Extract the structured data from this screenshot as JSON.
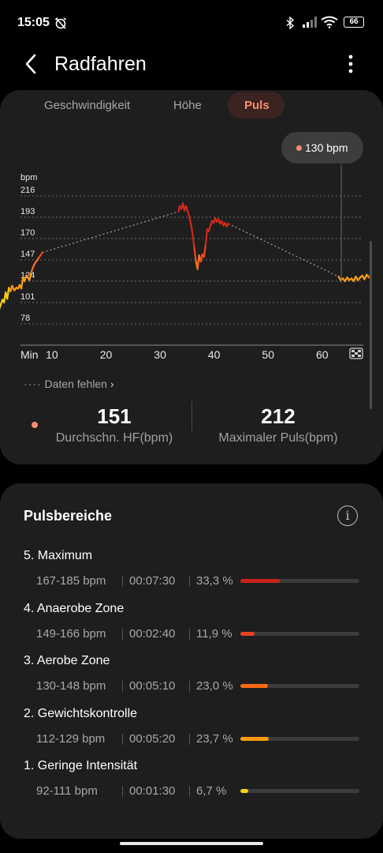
{
  "status": {
    "time": "15:05",
    "battery": "66"
  },
  "header": {
    "title": "Radfahren"
  },
  "tabs": [
    {
      "label": "Geschwindigkeit",
      "active": false
    },
    {
      "label": "Höhe",
      "active": false
    },
    {
      "label": "Puls",
      "active": true
    }
  ],
  "tooltip": {
    "label": "130 bpm"
  },
  "chart_data": {
    "type": "line",
    "ylabel": "bpm",
    "y_ticks": [
      "216",
      "193",
      "170",
      "147",
      "124",
      "101",
      "78"
    ],
    "x_ticks": [
      "Min",
      "10",
      "20",
      "30",
      "40",
      "50",
      "60"
    ],
    "ylim": [
      78,
      216
    ],
    "xlim": [
      0,
      66
    ],
    "grid": true,
    "marker_x": 63.5,
    "segments": [
      {
        "x": [
          0,
          0.4,
          0.8,
          1.1,
          1.4,
          1.7,
          2.0,
          2.3,
          2.6,
          3.0,
          3.4,
          3.7,
          4.0,
          4.3,
          4.6,
          4.9,
          5.2,
          5.5,
          5.8,
          6.1,
          6.4,
          6.7,
          7.0,
          7.3,
          7.6,
          7.9,
          8.2
        ],
        "y": [
          90,
          97,
          104,
          101,
          112,
          105,
          117,
          113,
          119,
          114,
          117,
          116,
          120,
          116,
          127,
          124,
          130,
          128,
          125,
          133,
          138,
          142,
          145,
          147,
          150,
          152,
          155
        ]
      },
      {
        "x": [
          33.4,
          33.6,
          33.9,
          34.2,
          34.5,
          34.8,
          35.1,
          35.4,
          35.7,
          36.0,
          36.3,
          36.6,
          36.9,
          37.2,
          37.5,
          37.8,
          38.1,
          38.4,
          38.7,
          39.0,
          39.3,
          39.6,
          39.9,
          40.2,
          40.5,
          40.8,
          41.1,
          41.4,
          41.7,
          42.0,
          42.3,
          42.6
        ],
        "y": [
          199,
          205,
          202,
          208,
          200,
          205,
          199,
          193,
          185,
          175,
          160,
          146,
          137,
          152,
          145,
          153,
          150,
          163,
          180,
          178,
          184,
          189,
          187,
          192,
          188,
          191,
          186,
          189,
          184,
          187,
          183,
          186
        ]
      },
      {
        "x": [
          63.0,
          63.4,
          63.8,
          64.2,
          64.6,
          65.0,
          65.4,
          65.8,
          66.2,
          66.6,
          67.0,
          67.4,
          67.8,
          68.2,
          68.6,
          69.0
        ],
        "y": [
          129,
          125,
          127,
          124,
          128,
          125,
          127,
          124,
          129,
          125,
          128,
          130,
          126,
          131,
          128,
          132
        ]
      }
    ],
    "gaps": [
      {
        "x": [
          8.2,
          33.4
        ],
        "y": [
          155,
          199
        ]
      },
      {
        "x": [
          42.6,
          63.0
        ],
        "y": [
          186,
          129
        ]
      }
    ]
  },
  "missing_data_label": "Daten fehlen",
  "stats": [
    {
      "value": "151",
      "label": "Durchschn. HF(bpm)"
    },
    {
      "value": "212",
      "label": "Maximaler Puls(bpm)"
    }
  ],
  "zones": {
    "title": "Pulsbereiche",
    "items": [
      {
        "name": "5. Maximum",
        "range": "167-185 bpm",
        "time": "00:07:30",
        "percent": "33,3 %",
        "fraction": 0.333,
        "color": "#c8231a"
      },
      {
        "name": "4. Anaerobe Zone",
        "range": "149-166 bpm",
        "time": "00:02:40",
        "percent": "11,9 %",
        "fraction": 0.119,
        "color": "#e8421f"
      },
      {
        "name": "3. Aerobe Zone",
        "range": "130-148 bpm",
        "time": "00:05:10",
        "percent": "23,0 %",
        "fraction": 0.23,
        "color": "#ff6a14"
      },
      {
        "name": "2. Gewichtskontrolle",
        "range": "112-129 bpm",
        "time": "00:05:20",
        "percent": "23,7 %",
        "fraction": 0.237,
        "color": "#ff9a12"
      },
      {
        "name": "1. Geringe Intensität",
        "range": "92-111 bpm",
        "time": "00:01:30",
        "percent": "6,7 %",
        "fraction": 0.067,
        "color": "#f5d313"
      }
    ]
  },
  "colors": {
    "background": "#000000",
    "card": "#1e1e1e",
    "accent": "#ff8a72"
  }
}
